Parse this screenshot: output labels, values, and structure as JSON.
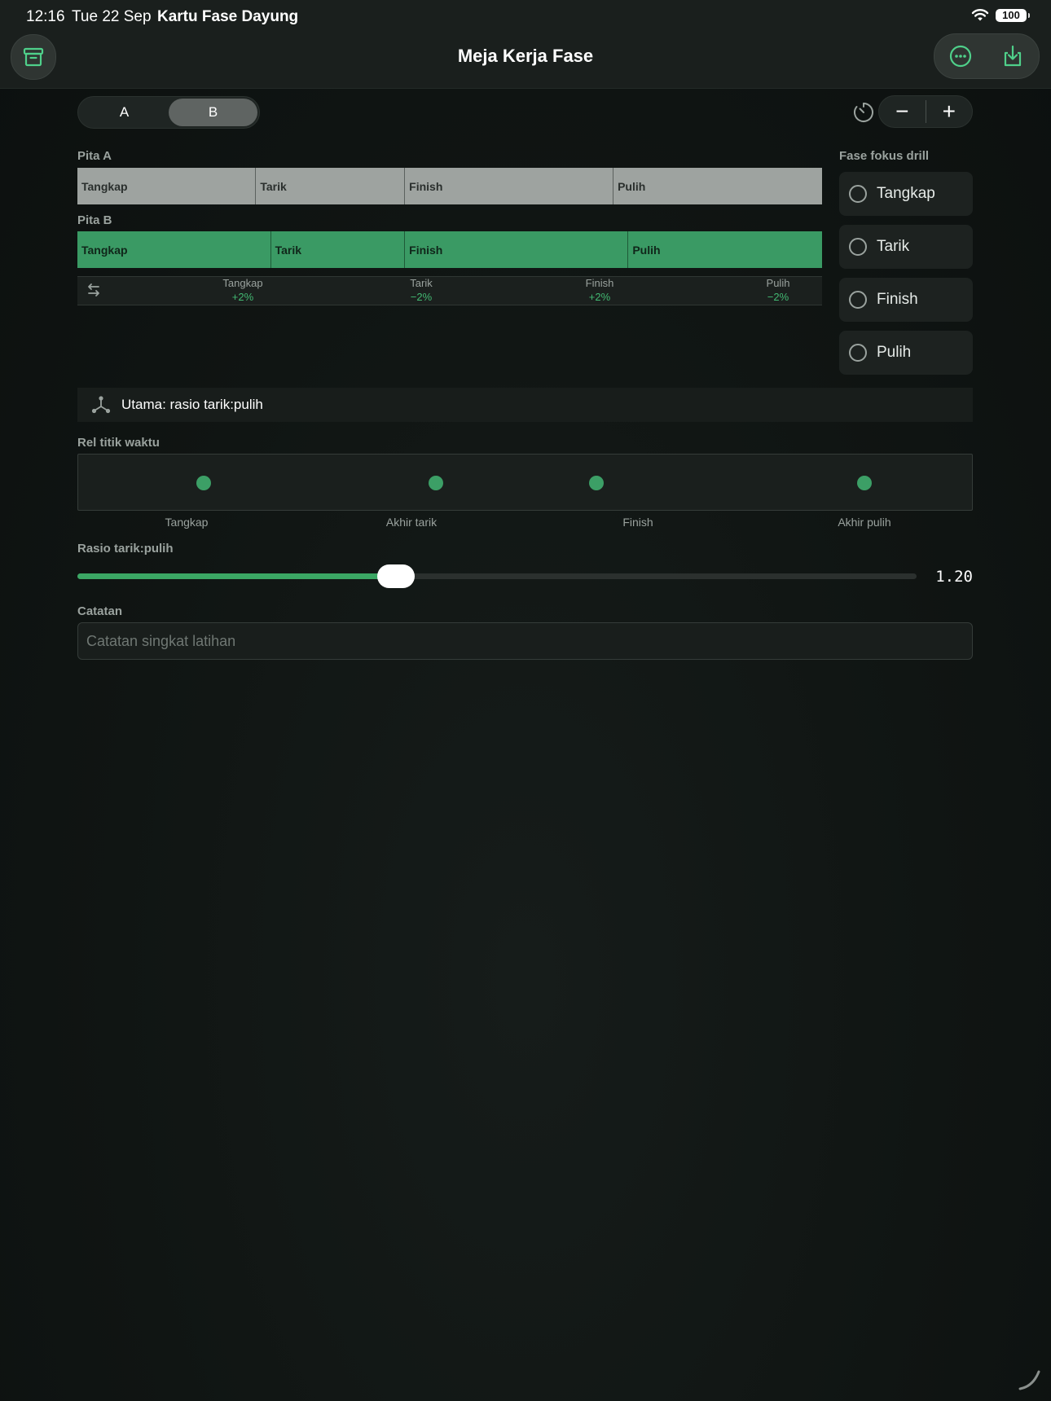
{
  "status": {
    "time": "12:16",
    "date": "Tue 22 Sep",
    "app": "Kartu Fase Dayung",
    "battery": "100"
  },
  "nav": {
    "title": "Meja Kerja Fase",
    "left_icon": "archive-icon",
    "right_icons": [
      "more-icon",
      "download-icon"
    ]
  },
  "segment": {
    "options": [
      "A",
      "B"
    ],
    "selected": "B"
  },
  "stepper": {
    "minus": "−",
    "plus": "+",
    "icon": "timer-icon"
  },
  "bands": {
    "a": {
      "label": "Pita A",
      "phases": [
        {
          "name": "Tangkap",
          "fraction": 0.24
        },
        {
          "name": "Tarik",
          "fraction": 0.2
        },
        {
          "name": "Finish",
          "fraction": 0.28
        },
        {
          "name": "Pulih",
          "fraction": 0.28
        }
      ]
    },
    "b": {
      "label": "Pita B",
      "phases": [
        {
          "name": "Tangkap",
          "fraction": 0.26
        },
        {
          "name": "Tarik",
          "fraction": 0.18
        },
        {
          "name": "Finish",
          "fraction": 0.3
        },
        {
          "name": "Pulih",
          "fraction": 0.26
        }
      ]
    }
  },
  "deltas": [
    {
      "name": "Tangkap",
      "value": "+2%"
    },
    {
      "name": "Tarik",
      "value": "−2%"
    },
    {
      "name": "Finish",
      "value": "+2%"
    },
    {
      "name": "Pulih",
      "value": "−2%"
    }
  ],
  "focus": {
    "title": "Fase fokus drill",
    "items": [
      "Tangkap",
      "Tarik",
      "Finish",
      "Pulih"
    ]
  },
  "primary": {
    "text": "Utama: rasio tarik:pulih",
    "icon": "hub-icon"
  },
  "rail": {
    "title": "Rel titik waktu",
    "points": [
      0.14,
      0.4,
      0.58,
      0.88
    ],
    "labels": [
      "Tangkap",
      "Akhir tarik",
      "Finish",
      "Akhir pulih"
    ]
  },
  "ratio": {
    "title": "Rasio tarik:pulih",
    "value_text": "1.20",
    "fraction": 0.38
  },
  "notes": {
    "title": "Catatan",
    "value": "",
    "placeholder": "Catatan singkat latihan"
  },
  "colors": {
    "accent": "#3a9a64",
    "accent_text": "#42b872",
    "band_a": "#9ea3a0"
  }
}
